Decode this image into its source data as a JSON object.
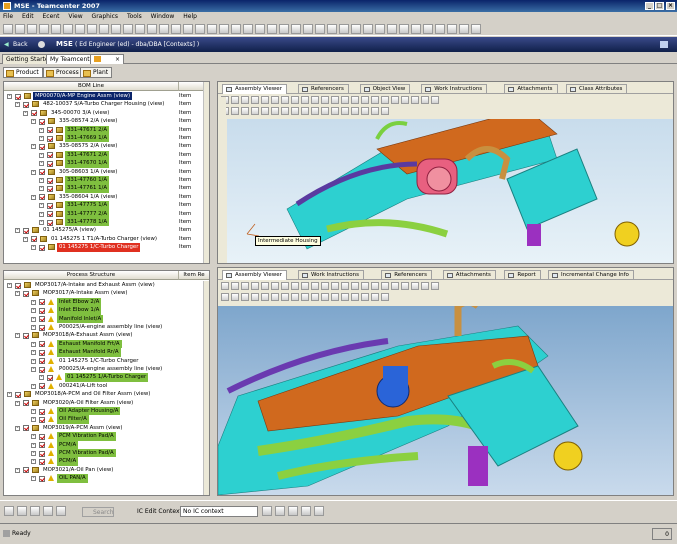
{
  "window": {
    "title": "MSE - Teamcenter 2007"
  },
  "menu": [
    "File",
    "Edit",
    "Ecent",
    "View",
    "Graphics",
    "Tools",
    "Window",
    "Help"
  ],
  "nav": {
    "back_label": "Back",
    "app_label": "MSE",
    "user_info": "( Ed Engineer (ed) - dba/DBA  [Contexts] )"
  },
  "app_tabs": [
    "Getting Started",
    "My Teamcenter"
  ],
  "perspectives": [
    "Product",
    "Process",
    "Plant"
  ],
  "bom": {
    "header": "BOM Line",
    "rows": [
      {
        "text": "MP00070/A-MP Engine Assm (view)",
        "type": "Item",
        "level": 0,
        "hl": "",
        "sel": true
      },
      {
        "text": "482-10037 S/A-Turbo Charger Housing (view)",
        "type": "Item",
        "level": 1,
        "hl": ""
      },
      {
        "text": "345-00070 3/A (view)",
        "type": "Item",
        "level": 2,
        "hl": ""
      },
      {
        "text": "335-08574 2/A (view)",
        "type": "Item",
        "level": 3,
        "hl": ""
      },
      {
        "text": "331-47671 2/A",
        "type": "Item",
        "level": 4,
        "hl": "green"
      },
      {
        "text": "331-47669 1/A",
        "type": "Item",
        "level": 4,
        "hl": "green"
      },
      {
        "text": "335-08575 2/A (view)",
        "type": "Item",
        "level": 3,
        "hl": ""
      },
      {
        "text": "331-47671 2/A",
        "type": "Item",
        "level": 4,
        "hl": "green"
      },
      {
        "text": "331-47670 1/A",
        "type": "Item",
        "level": 4,
        "hl": "green"
      },
      {
        "text": "305-08603 1/A (view)",
        "type": "Item",
        "level": 3,
        "hl": ""
      },
      {
        "text": "331-47760 1/A",
        "type": "Item",
        "level": 4,
        "hl": "green"
      },
      {
        "text": "331-47761 1/A",
        "type": "Item",
        "level": 4,
        "hl": "green"
      },
      {
        "text": "335-08604 1/A (view)",
        "type": "Item",
        "level": 3,
        "hl": ""
      },
      {
        "text": "331-47775 1/A",
        "type": "Item",
        "level": 4,
        "hl": "green"
      },
      {
        "text": "331-47777 2/A",
        "type": "Item",
        "level": 4,
        "hl": "green"
      },
      {
        "text": "331-47778 1/A",
        "type": "Item",
        "level": 4,
        "hl": "green"
      },
      {
        "text": "01 145275/A (view)",
        "type": "Item",
        "level": 1,
        "hl": ""
      },
      {
        "text": "01 145275 1 T1/A-Turbo Charger (view)",
        "type": "Item",
        "level": 2,
        "hl": ""
      },
      {
        "text": "01 145275 1/C-Turbo Charger",
        "type": "Item",
        "level": 3,
        "hl": "red"
      }
    ]
  },
  "process": {
    "headers": [
      "Process Structure",
      "Item Re"
    ],
    "rows": [
      {
        "text": "MOP3017/A-Intake and Exhaust Assm (view)",
        "level": 0,
        "hl": ""
      },
      {
        "text": "MOP3017/A-Intake Assm (view)",
        "level": 1,
        "hl": ""
      },
      {
        "text": "Inlet Elbow 2/A",
        "level": 3,
        "hl": "green"
      },
      {
        "text": "Inlet Elbow 1/A",
        "level": 3,
        "hl": "green"
      },
      {
        "text": "Manifold Inlet/A",
        "level": 3,
        "hl": "green"
      },
      {
        "text": "P00025/A-engine assembly line (view)",
        "level": 3,
        "hl": ""
      },
      {
        "text": "MOP3018/A-Exhaust Assm (view)",
        "level": 1,
        "hl": ""
      },
      {
        "text": "Exhaust Manifold Frt/A",
        "level": 3,
        "hl": "green"
      },
      {
        "text": "Exhaust Manifold Rr/A",
        "level": 3,
        "hl": "green"
      },
      {
        "text": "01 145275 1/C-Turbo Charger",
        "level": 3,
        "hl": ""
      },
      {
        "text": "P00025/A-engine assembly line (view)",
        "level": 3,
        "hl": ""
      },
      {
        "text": "01 145275 1/A-Turbo Charger",
        "level": 4,
        "hl": "green"
      },
      {
        "text": "000241/A-Lift tool",
        "level": 3,
        "hl": ""
      },
      {
        "text": "MOP3018/A-PCM and Oil Filter Assm (view)",
        "level": 0,
        "hl": ""
      },
      {
        "text": "MOP3020/A-Oil Filter Assm (view)",
        "level": 1,
        "hl": ""
      },
      {
        "text": "Oil Adapter Housing/A",
        "level": 3,
        "hl": "green"
      },
      {
        "text": "Oil Filter/A",
        "level": 3,
        "hl": "green"
      },
      {
        "text": "MOP3019/A-PCM Assm (view)",
        "level": 1,
        "hl": ""
      },
      {
        "text": "PCM Vibration Pad/A",
        "level": 3,
        "hl": "green"
      },
      {
        "text": "PCM/A",
        "level": 3,
        "hl": "green"
      },
      {
        "text": "PCM Vibration Pad/A",
        "level": 3,
        "hl": "green"
      },
      {
        "text": "PCM/A",
        "level": 3,
        "hl": "green"
      },
      {
        "text": "MOP3021/A-Oil Pan (view)",
        "level": 1,
        "hl": ""
      },
      {
        "text": "OIL PAN/A",
        "level": 3,
        "hl": "green"
      }
    ]
  },
  "top_viewer": {
    "tabs": [
      "Assembly Viewer",
      "Referencers",
      "Object View",
      "Work Instructions",
      "Attachments",
      "Class Attributes"
    ],
    "tooltip": "Intermediate Housing"
  },
  "bottom_viewer": {
    "tabs": [
      "Assembly Viewer",
      "Work Instructions",
      "Referencers",
      "Attachments",
      "Report",
      "Incremental Change Info"
    ]
  },
  "bottom_bar": {
    "search_label": "Search",
    "ic_label": "IC Edit Context:",
    "ic_value": "No IC context"
  },
  "status": {
    "text": "Ready",
    "count": "0"
  },
  "colors": {
    "highlight_green": "#7fbf3f",
    "highlight_red": "#e03020",
    "title_blue": "#0a246a"
  }
}
